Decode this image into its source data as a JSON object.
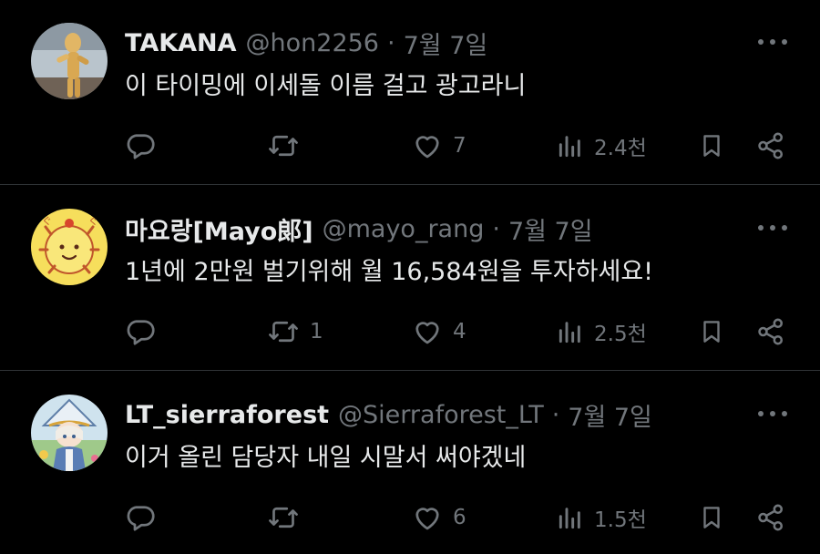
{
  "colors": {
    "background": "#000000",
    "text": "#e7e9ea",
    "secondary": "#71767b",
    "divider": "#2f3336"
  },
  "tweets": [
    {
      "name": "TAKANA",
      "handle": "@hon2256",
      "separator": "·",
      "date": "7월 7일",
      "text": "이 타이밍에 이세돌 이름 걸고 광고라니",
      "replies": "",
      "retweets": "",
      "likes": "7",
      "views": "2.4천",
      "avatar_icon": "wooden-mannequin-avatar"
    },
    {
      "name": "마요랑[Mayo郞]",
      "handle": "@mayo_rang",
      "separator": "·",
      "date": "7월 7일",
      "text": "1년에 2만원 벌기위해 월 16,584원을 투자하세요!",
      "replies": "",
      "retweets": "1",
      "likes": "4",
      "views": "2.5천",
      "avatar_icon": "yellow-sun-avatar"
    },
    {
      "name": "LT_sierraforest",
      "handle": "@Sierraforest_LT",
      "separator": "·",
      "date": "7월 7일",
      "text": "이거 올린 담당자 내일 시말서 써야겠네",
      "replies": "",
      "retweets": "",
      "likes": "6",
      "views": "1.5천",
      "avatar_icon": "anime-character-avatar"
    }
  ]
}
